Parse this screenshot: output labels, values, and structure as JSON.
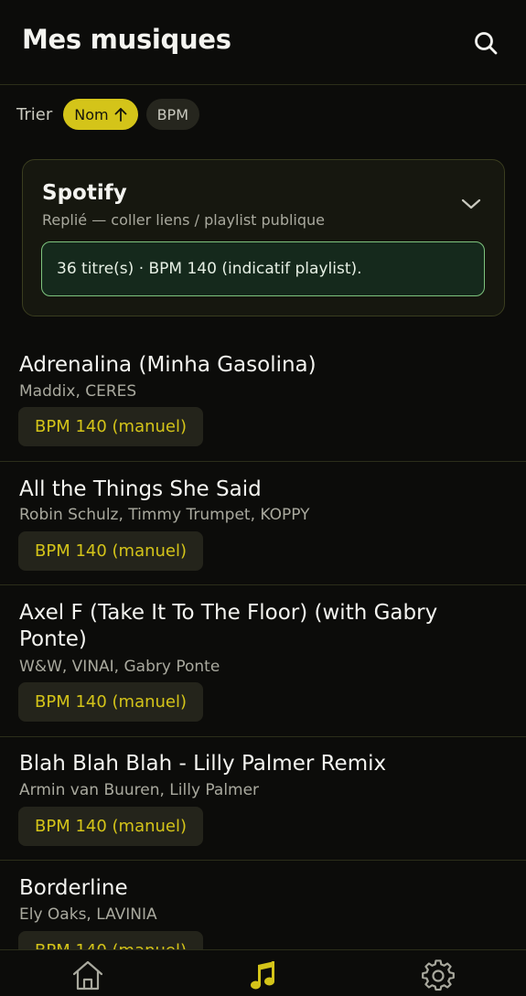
{
  "header": {
    "title": "Mes musiques"
  },
  "sort": {
    "label": "Trier",
    "options": [
      {
        "label": "Nom",
        "active": true
      },
      {
        "label": "BPM",
        "active": false
      }
    ]
  },
  "spotify": {
    "title": "Spotify",
    "subtitle": "Replié — coller liens / playlist publique",
    "status": "36 titre(s) · BPM 140 (indicatif playlist)."
  },
  "tracks": [
    {
      "title": "Adrenalina (Minha Gasolina)",
      "artists": "Maddix, CERES",
      "bpm": "BPM 140 (manuel)"
    },
    {
      "title": "All the Things She Said",
      "artists": "Robin Schulz, Timmy Trumpet, KOPPY",
      "bpm": "BPM 140 (manuel)"
    },
    {
      "title": "Axel F (Take It To The Floor) (with Gabry Ponte)",
      "artists": "W&W, VINAI, Gabry Ponte",
      "bpm": "BPM 140 (manuel)"
    },
    {
      "title": "Blah Blah Blah - Lilly Palmer Remix",
      "artists": "Armin van Buuren, Lilly Palmer",
      "bpm": "BPM 140 (manuel)"
    },
    {
      "title": "Borderline",
      "artists": "Ely Oaks, LAVINIA",
      "bpm": "BPM 140 (manuel)"
    }
  ],
  "colors": {
    "accent": "#d4c419",
    "background": "#0c0c0a",
    "status_border": "#7ec47e"
  },
  "icons": {
    "search": "search-icon",
    "sort_direction": "arrow-up-icon",
    "expand": "chevron-down-icon",
    "nav_home": "home-icon",
    "nav_music": "music-note-icon",
    "nav_settings": "gear-icon"
  }
}
